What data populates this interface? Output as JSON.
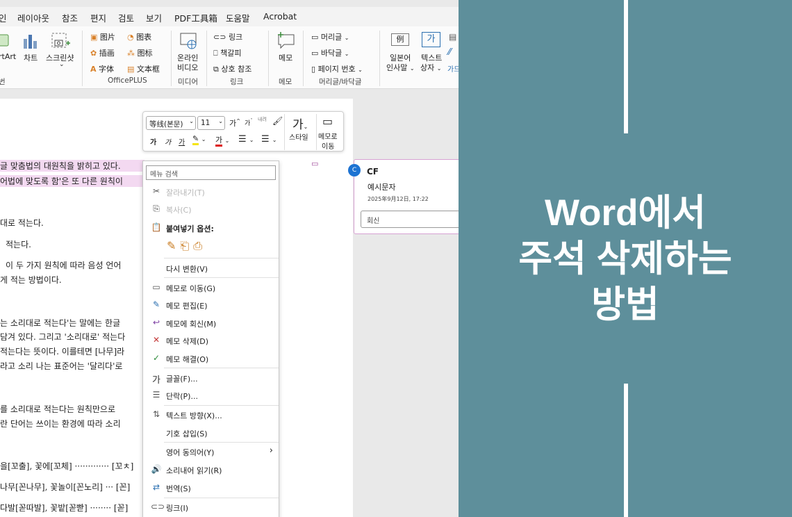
{
  "menubar": {
    "items": [
      "인",
      "레이아웃",
      "참조",
      "편지",
      "검토",
      "보기",
      "PDF工具箱",
      "도움말",
      "Acrobat"
    ]
  },
  "ribbon": {
    "artart_label": "rtArt",
    "chart_label": "차트",
    "screenshot_label": "스크린샷",
    "officeplus": {
      "picture": "图片",
      "chart": "图表",
      "illustration": "插画",
      "icon": "图标",
      "font": "字体",
      "textbox": "文本框",
      "group_label": "OfficePLUS"
    },
    "online_video": {
      "line1": "온라인",
      "line2": "비디오",
      "group_label": "미디어"
    },
    "links": {
      "link": "링크",
      "bookmark": "책갈피",
      "crossref": "상호 참조",
      "group_label": "링크"
    },
    "memo": {
      "label": "메모",
      "group_label": "메모"
    },
    "headerfooter": {
      "header": "머리글",
      "footer": "바닥글",
      "page_number": "페이지 번호",
      "group_label": "머리글/바닥글"
    },
    "japanese": {
      "line1": "일본어",
      "line2": "인사말",
      "icon": "例"
    },
    "textbox": {
      "line1": "텍스트",
      "line2": "상자",
      "icon": "가"
    },
    "cutoff": "가드",
    "left_group": "번"
  },
  "document": {
    "lines": [
      "글 맞춤법의 대원칙을 밝히고 있다.",
      "어법에 맞도록 함'은 또 다른 원칙이",
      "대로 적는다.",
      "적는다.",
      "이 두 가지 원칙에 따라 음성 언어",
      "게 적는 방법이다.",
      "는 소리대로 적는다'는 말에는 한글",
      "담겨 있다. 그리고 '소리대로' 적는다",
      "적는다는 뜻이다. 이를테면 [나무]라",
      "라고 소리 나는 표준어는 '달리다'로",
      "를 소리대로 적는다는 원칙만으로",
      "란 단어는 쓰이는 환경에 따라 소리",
      "을[꼬출], 꽃에[꼬체] ············· [꼬ㅊ]",
      "나무[꼰나무], 꽃놀이[꼰노리] ··· [꼰]",
      "다발[꼳따발], 꽃밭[꼳빧] ········ [꼳]"
    ]
  },
  "mini_toolbar": {
    "font_name": "等线(본문)",
    "font_size": "11",
    "grow_font": "가",
    "shrink_font": "가",
    "clear_format": "내려",
    "bold": "가",
    "italic": "가",
    "underline": "가",
    "font_color": "가",
    "style_icon": "가",
    "style_label": "스타일",
    "memo_line1": "메모로",
    "memo_line2": "이동"
  },
  "comment": {
    "avatar": "C",
    "author": "CF",
    "text": "예시문자",
    "timestamp": "2025年9月12日, 17:22",
    "reply_placeholder": "회신"
  },
  "context_menu": {
    "search_placeholder": "메뉴 검색",
    "cut": "잘라내기(T)",
    "copy": "복사(C)",
    "paste_options": "붙여넣기 옵션:",
    "reconvert": "다시 변환(V)",
    "goto_memo": "메모로 이동(G)",
    "edit_memo": "메모 편집(E)",
    "reply_memo": "메모에 회신(M)",
    "delete_memo": "메모 삭제(D)",
    "resolve_memo": "메모 해결(O)",
    "font": "글꼴(F)...",
    "paragraph": "단락(P)...",
    "text_direction": "텍스트 방향(X)...",
    "insert_symbol": "기호 삽입(S)",
    "synonyms": "영어 동의어(Y)",
    "read_aloud": "소리내어 읽기(R)",
    "translate": "번역(S)",
    "link": "링크(I)"
  },
  "banner": {
    "title_lines": [
      "Word에서",
      "주석 삭제하는",
      "방법"
    ],
    "background": "#5e8f9b"
  }
}
